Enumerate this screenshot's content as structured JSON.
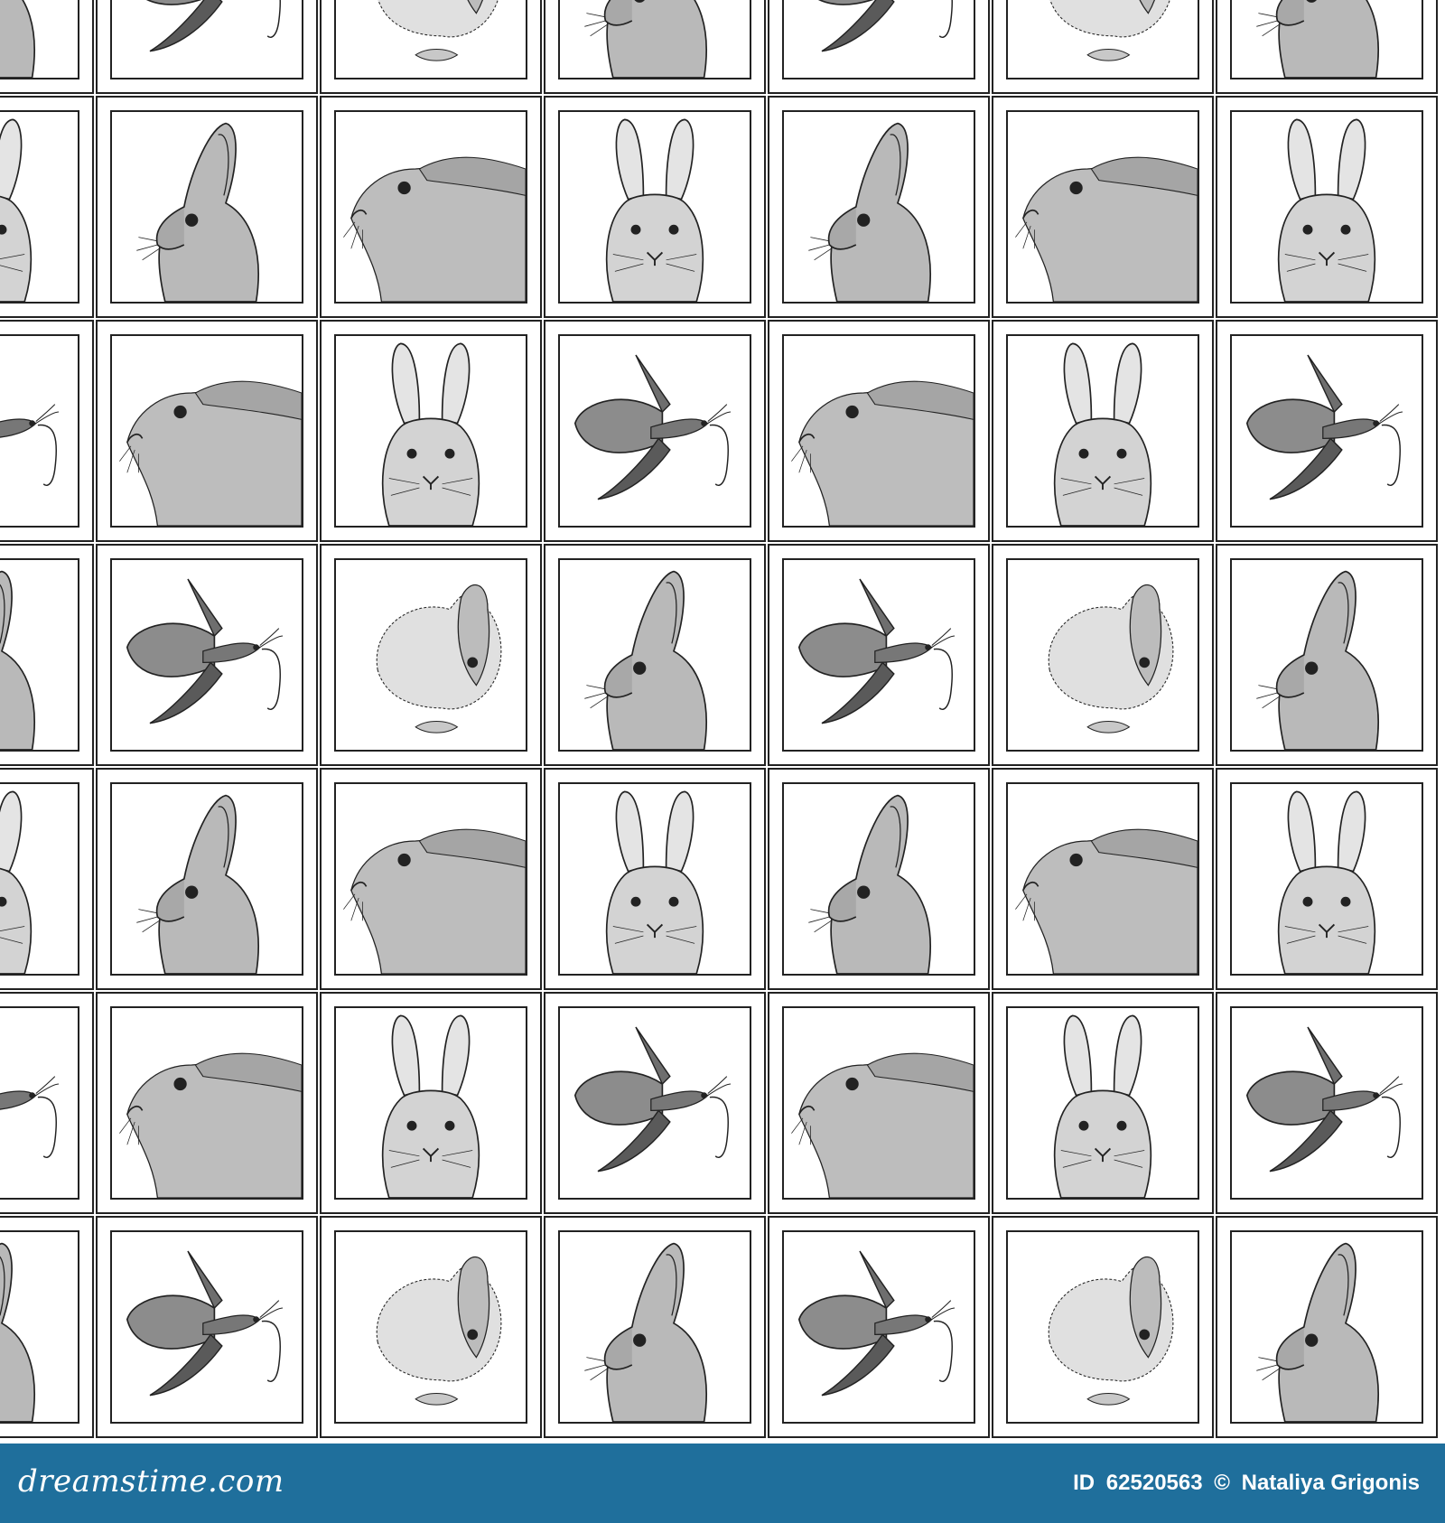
{
  "footer": {
    "logo_text": "dreamstime.com",
    "id_label": "ID",
    "image_id": "62520563",
    "copyright_symbol": "©",
    "author": "Nataliya Grigonis",
    "background_color": "#1f6f9c"
  },
  "pattern": {
    "frame_color": "#222222",
    "motifs": [
      "rabbit-profile-icon",
      "hare-lying-icon",
      "rabbit-front-icon",
      "moth-icon",
      "rabbit-back-icon"
    ],
    "rows": [
      [
        "rabbit-profile",
        "moth",
        "rabbit-back",
        "rabbit-profile",
        "moth",
        "rabbit-back",
        "rabbit-profile"
      ],
      [
        "rabbit-front",
        "rabbit-profile",
        "hare-lying",
        "rabbit-front",
        "rabbit-profile",
        "hare-lying",
        "rabbit-front"
      ],
      [
        "moth",
        "hare-lying",
        "rabbit-front",
        "moth",
        "hare-lying",
        "rabbit-front",
        "moth"
      ],
      [
        "rabbit-profile",
        "moth",
        "rabbit-back",
        "rabbit-profile",
        "moth",
        "rabbit-back",
        "rabbit-profile"
      ],
      [
        "rabbit-front",
        "rabbit-profile",
        "hare-lying",
        "rabbit-front",
        "rabbit-profile",
        "hare-lying",
        "rabbit-front"
      ],
      [
        "moth",
        "hare-lying",
        "rabbit-front",
        "moth",
        "hare-lying",
        "rabbit-front",
        "moth"
      ],
      [
        "rabbit-profile",
        "moth",
        "rabbit-back",
        "rabbit-profile",
        "moth",
        "rabbit-back",
        "rabbit-profile"
      ]
    ]
  }
}
